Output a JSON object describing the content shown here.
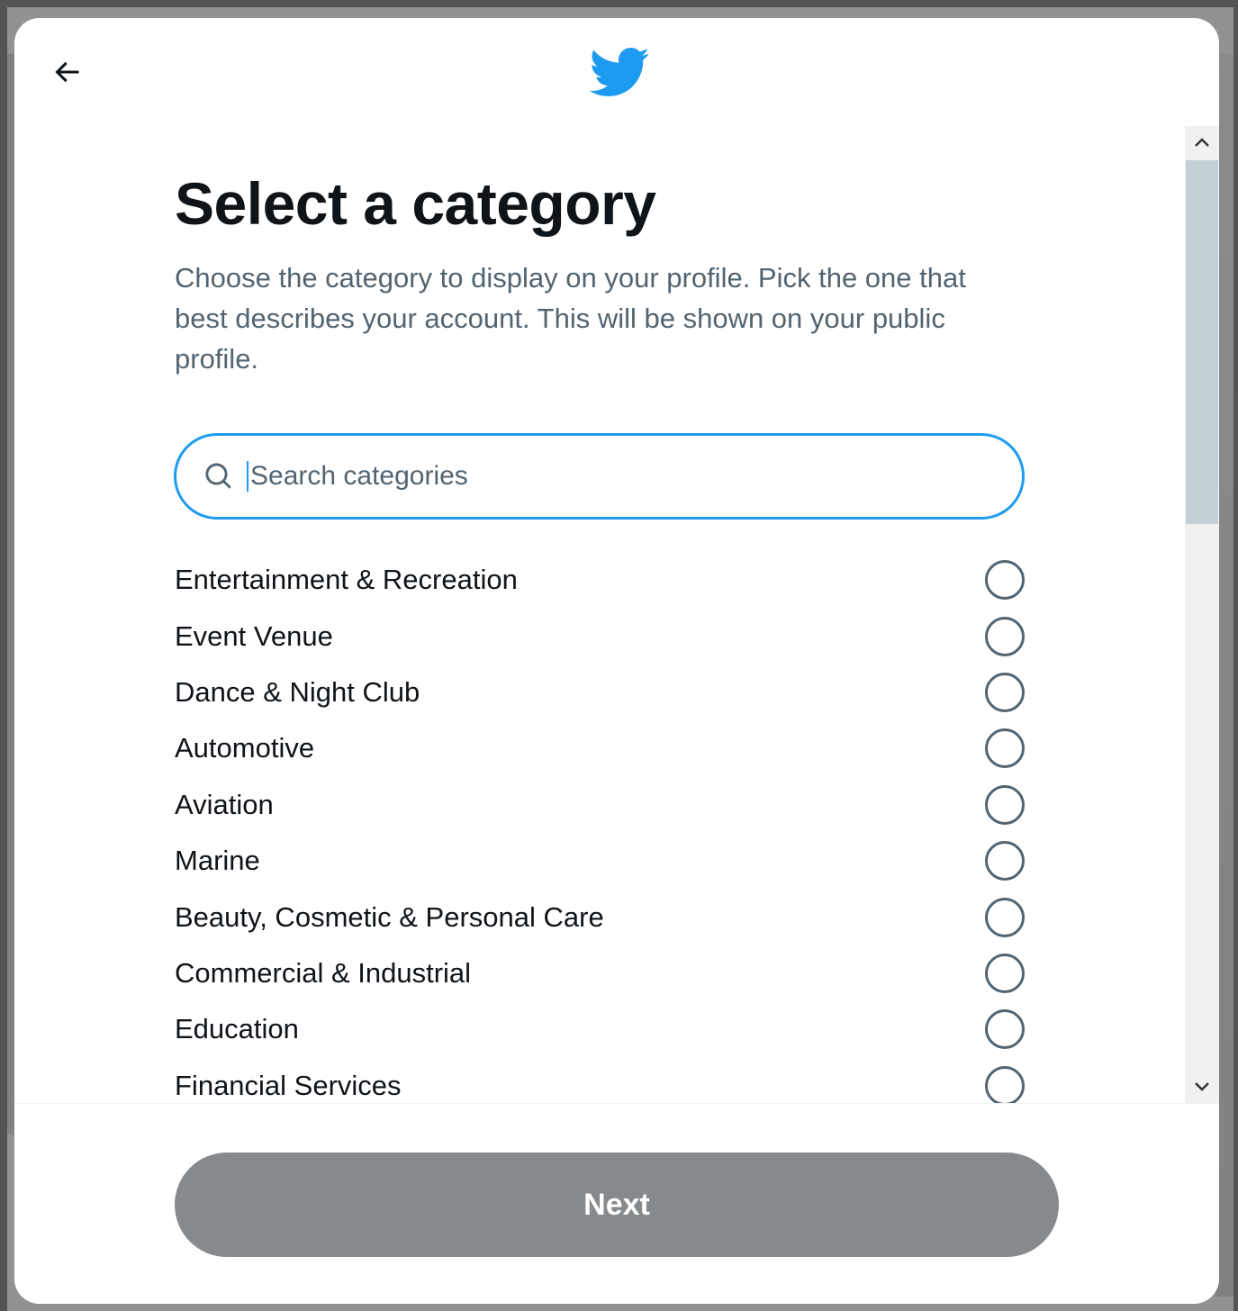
{
  "header": {
    "back_icon": "arrow-left-icon",
    "logo_icon": "twitter-bird-icon",
    "brand_color": "#1d9bf0"
  },
  "main": {
    "title": "Select a category",
    "description": "Choose the category to display on your profile. Pick the one that best describes your account. This will be shown on your public profile."
  },
  "search": {
    "placeholder": "Search categories",
    "value": ""
  },
  "categories": [
    {
      "label": "Entertainment & Recreation",
      "selected": false
    },
    {
      "label": "Event Venue",
      "selected": false
    },
    {
      "label": "Dance & Night Club",
      "selected": false
    },
    {
      "label": "Automotive",
      "selected": false
    },
    {
      "label": "Aviation",
      "selected": false
    },
    {
      "label": "Marine",
      "selected": false
    },
    {
      "label": "Beauty, Cosmetic & Personal Care",
      "selected": false
    },
    {
      "label": "Commercial & Industrial",
      "selected": false
    },
    {
      "label": "Education",
      "selected": false
    },
    {
      "label": "Financial Services",
      "selected": false
    }
  ],
  "footer": {
    "next_label": "Next",
    "next_color": "#878a8c",
    "next_disabled": true
  }
}
